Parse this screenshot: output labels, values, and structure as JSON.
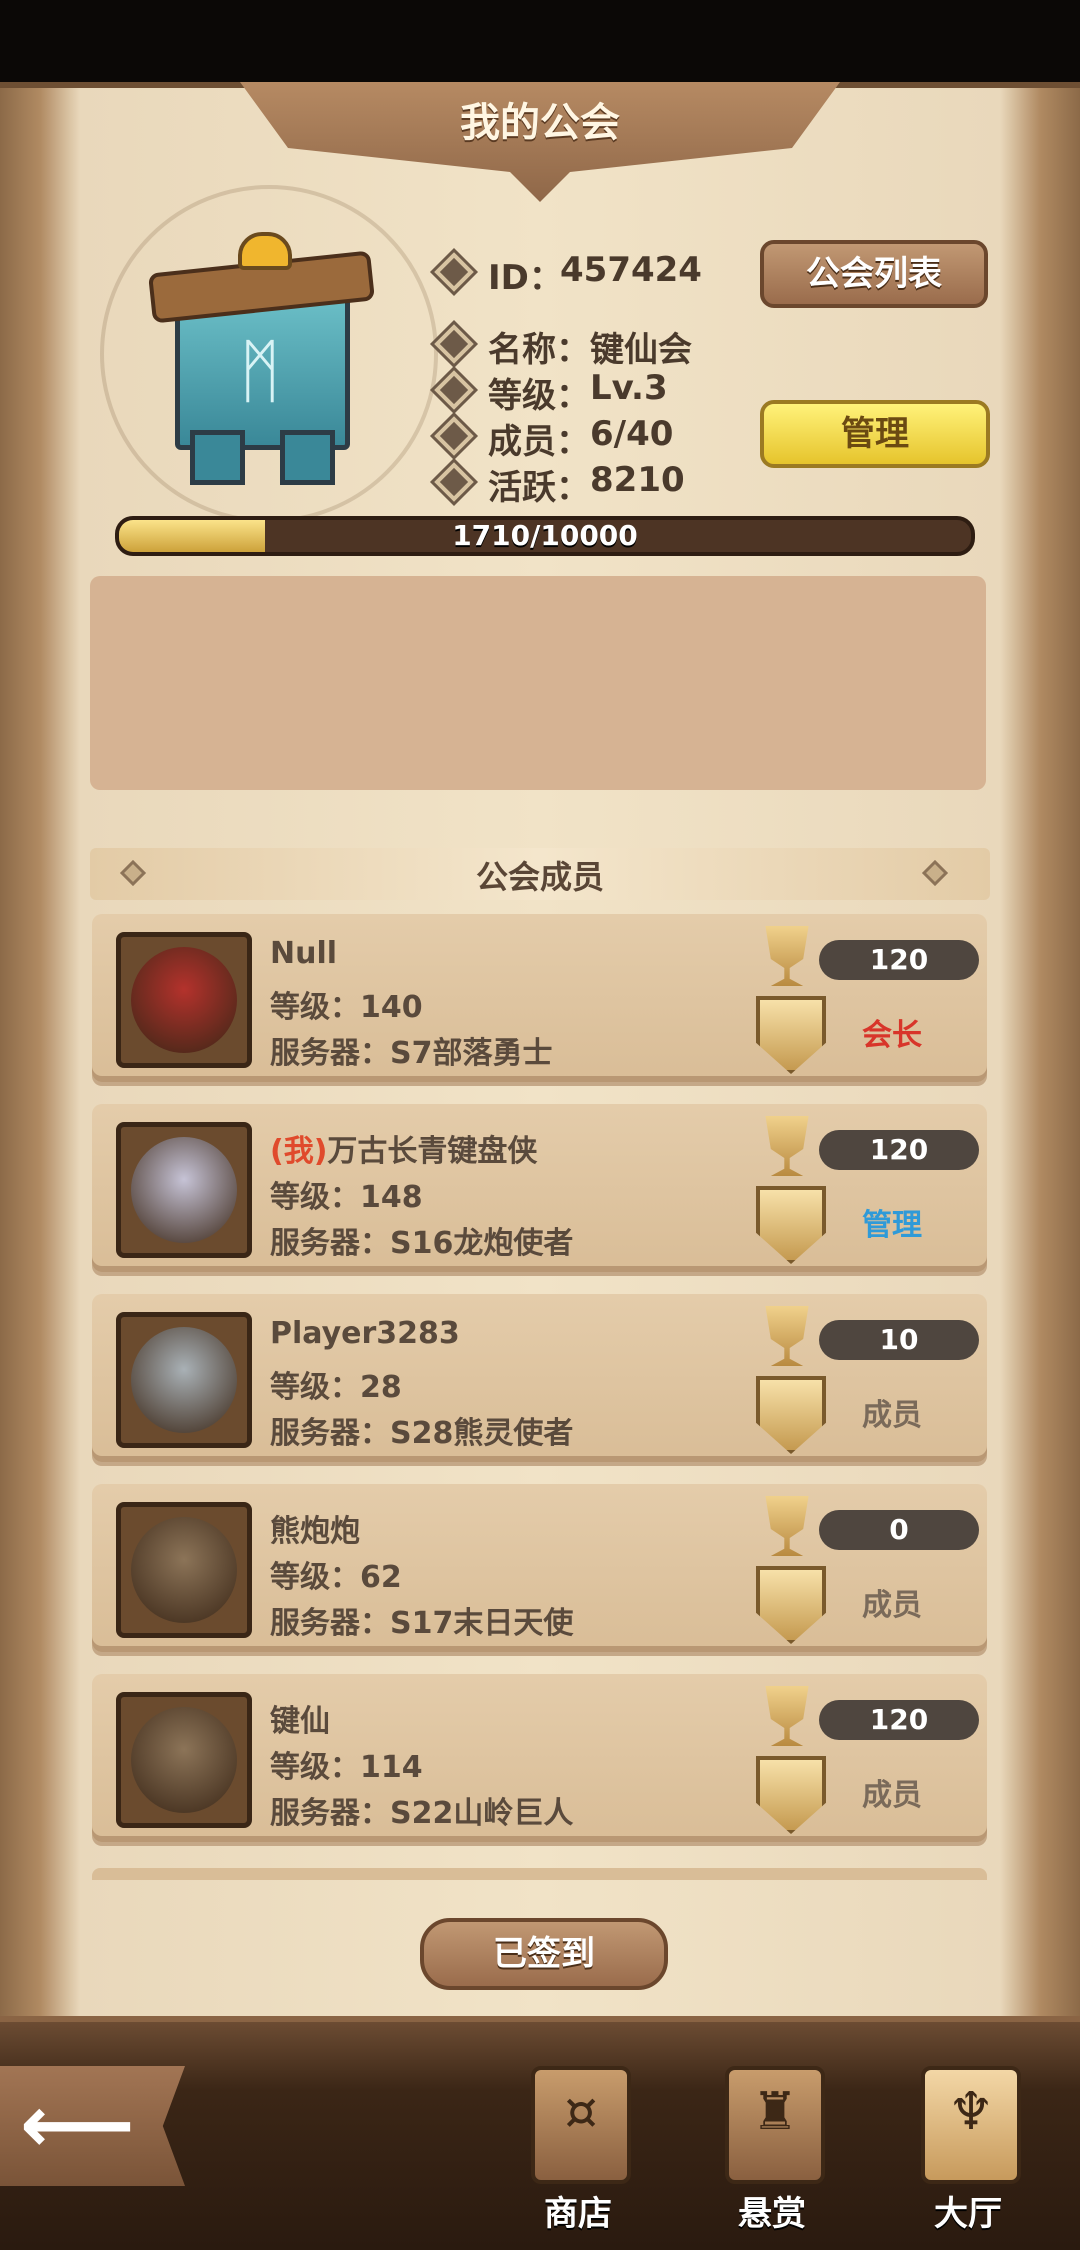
{
  "header": {
    "title": "我的公会"
  },
  "guild": {
    "id_label": "ID：",
    "id_value": "457424",
    "name_label": "名称：",
    "name_value": "键仙会",
    "level_label": "等级：",
    "level_value": "Lv.3",
    "members_label": "成员：",
    "members_value": "6/40",
    "activity_label": "活跃：",
    "activity_value": "8210",
    "guild_list_button": "公会列表",
    "manage_button": "管理",
    "emblem_icon": "guild-banner-icon"
  },
  "xp": {
    "text": "1710/10000",
    "current": 1710,
    "max": 10000
  },
  "notice": {
    "text": ""
  },
  "members_section": {
    "title": "公会成员"
  },
  "members": [
    {
      "me_tag": "",
      "name": "Null",
      "level": "等级：140",
      "server": "服务器：S7部落勇士",
      "score": "120",
      "role": "会长",
      "role_color": "#d8352a",
      "avatar_color": "#b4322c"
    },
    {
      "me_tag": "(我)",
      "name": "万古长青键盘侠",
      "level": "等级：148",
      "server": "服务器：S16龙炮使者",
      "score": "120",
      "role": "管理",
      "role_color": "#2f9ad8",
      "avatar_color": "#c6c3d6"
    },
    {
      "me_tag": "",
      "name": "Player3283",
      "level": "等级：28",
      "server": "服务器：S28熊灵使者",
      "score": "10",
      "role": "成员",
      "role_color": "#7a6a5a",
      "avatar_color": "#a9b1b6"
    },
    {
      "me_tag": "",
      "name": "熊炮炮",
      "level": "等级：62",
      "server": "服务器：S17末日天使",
      "score": "0",
      "role": "成员",
      "role_color": "#7a6a5a",
      "avatar_color": "#8c7458"
    },
    {
      "me_tag": "",
      "name": "键仙",
      "level": "等级：114",
      "server": "服务器：S22山岭巨人",
      "score": "120",
      "role": "成员",
      "role_color": "#7a6a5a",
      "avatar_color": "#8c7458"
    }
  ],
  "signin": {
    "label": "已签到"
  },
  "bottom_nav": {
    "back_icon": "back-arrow-icon",
    "items": [
      {
        "label": "商店",
        "icon": "shop-icon"
      },
      {
        "label": "悬赏",
        "icon": "bounty-icon"
      },
      {
        "label": "大厅",
        "icon": "hall-icon"
      }
    ]
  },
  "colors": {
    "accent_gold": "#e6c42c",
    "panel": "#f1e3c7",
    "bar_fill": "#cda23a"
  }
}
